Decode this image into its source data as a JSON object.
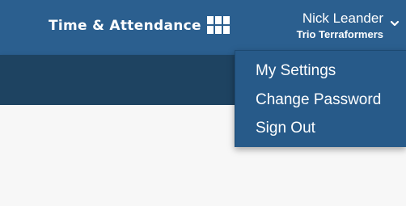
{
  "header": {
    "app_title": "Time & Attendance",
    "apps_icon": "grid-icon",
    "user": {
      "name": "Nick Leander",
      "organization": "Trio Terraformers",
      "menu_icon": "chevron-down-icon"
    }
  },
  "user_menu": {
    "items": [
      {
        "label": "My Settings"
      },
      {
        "label": "Change Password"
      },
      {
        "label": "Sign Out"
      }
    ]
  },
  "colors": {
    "header_bg": "#2b5f8f",
    "subbar_bg": "#1e4361",
    "menu_bg": "#275a89",
    "content_bg": "#f7f7f7",
    "text": "#ffffff"
  }
}
